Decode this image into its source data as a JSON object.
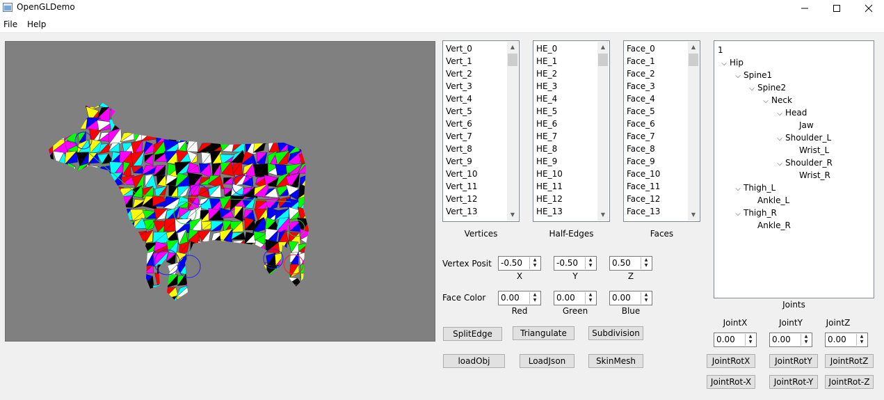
{
  "window": {
    "title": "OpenGLDemo",
    "buttons": {
      "minimize": "—",
      "maximize": "☐",
      "close": "✕"
    }
  },
  "menu": {
    "file": "File",
    "help": "Help"
  },
  "lists": {
    "vertices": {
      "caption": "Vertices",
      "items": [
        "Vert_0",
        "Vert_1",
        "Vert_2",
        "Vert_3",
        "Vert_4",
        "Vert_5",
        "Vert_6",
        "Vert_7",
        "Vert_8",
        "Vert_9",
        "Vert_10",
        "Vert_11",
        "Vert_12",
        "Vert_13"
      ]
    },
    "half_edges": {
      "caption": "Half-Edges",
      "items": [
        "HE_0",
        "HE_1",
        "HE_2",
        "HE_3",
        "HE_4",
        "HE_5",
        "HE_6",
        "HE_7",
        "HE_8",
        "HE_9",
        "HE_10",
        "HE_11",
        "HE_12",
        "HE_13"
      ]
    },
    "faces": {
      "caption": "Faces",
      "items": [
        "Face_0",
        "Face_1",
        "Face_2",
        "Face_3",
        "Face_4",
        "Face_5",
        "Face_6",
        "Face_7",
        "Face_8",
        "Face_9",
        "Face_10",
        "Face_11",
        "Face_12",
        "Face_13"
      ]
    }
  },
  "vertex_position": {
    "label": "Vertex Positi",
    "x": {
      "value": "-0.50",
      "label": "X"
    },
    "y": {
      "value": "-0.50",
      "label": "Y"
    },
    "z": {
      "value": "0.50",
      "label": "Z"
    }
  },
  "face_color": {
    "label": "Face Color",
    "red": {
      "value": "0.00",
      "label": "Red"
    },
    "green": {
      "value": "0.00",
      "label": "Green"
    },
    "blue": {
      "value": "0.00",
      "label": "Blue"
    }
  },
  "buttons": {
    "split_edge": "SplitEdge",
    "triangulate": "Triangulate",
    "subdivision": "Subdivision",
    "load_obj": "loadObj",
    "load_json": "LoadJson",
    "skin_mesh": "SkinMesh"
  },
  "joints_tree": {
    "caption": "Joints",
    "root": "1",
    "nodes": [
      {
        "label": "Hip",
        "depth": 0,
        "expanded": true
      },
      {
        "label": "Spine1",
        "depth": 1,
        "expanded": true
      },
      {
        "label": "Spine2",
        "depth": 2,
        "expanded": true
      },
      {
        "label": "Neck",
        "depth": 3,
        "expanded": true
      },
      {
        "label": "Head",
        "depth": 4,
        "expanded": true
      },
      {
        "label": "Jaw",
        "depth": 5,
        "expanded": false
      },
      {
        "label": "Shoulder_L",
        "depth": 4,
        "expanded": true
      },
      {
        "label": "Wrist_L",
        "depth": 5,
        "expanded": false
      },
      {
        "label": "Shoulder_R",
        "depth": 4,
        "expanded": true
      },
      {
        "label": "Wrist_R",
        "depth": 5,
        "expanded": false
      },
      {
        "label": "Thigh_L",
        "depth": 1,
        "expanded": true
      },
      {
        "label": "Ankle_L",
        "depth": 2,
        "expanded": false
      },
      {
        "label": "Thigh_R",
        "depth": 1,
        "expanded": true
      },
      {
        "label": "Ankle_R",
        "depth": 2,
        "expanded": false
      }
    ]
  },
  "joint_translation": {
    "x": {
      "label": "JointX",
      "value": "0.00"
    },
    "y": {
      "label": "JointY",
      "value": "0.00"
    },
    "z": {
      "label": "JointZ",
      "value": "0.00"
    }
  },
  "joint_rotation": {
    "rot_x": "JointRotX",
    "rot_y": "JointRotY",
    "rot_z": "JointRotZ",
    "rot_neg_x": "JointRot-X",
    "rot_neg_y": "JointRot-Y",
    "rot_neg_z": "JointRot-Z"
  },
  "colors": {
    "viewport_bg": "#808080",
    "window_bg": "#f0f0f0",
    "mesh_palette": [
      "#ff0000",
      "#00ff00",
      "#0000ff",
      "#ffff00",
      "#ff00ff",
      "#00ffff",
      "#000000",
      "#ffffff"
    ]
  }
}
